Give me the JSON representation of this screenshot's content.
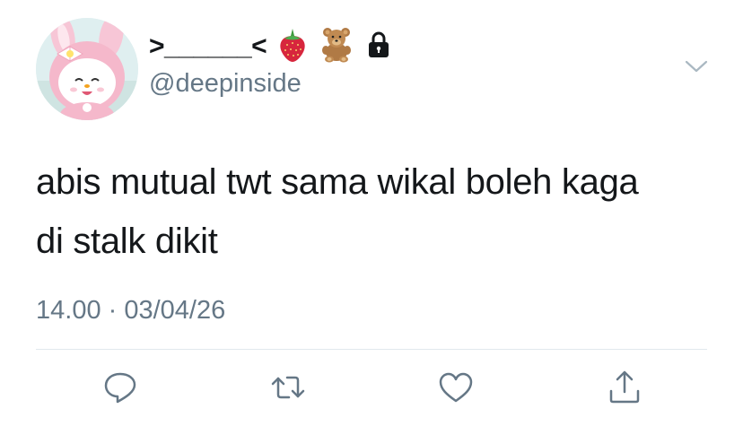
{
  "user": {
    "display_name": ">______<",
    "name_emojis": [
      "strawberry-icon",
      "teddy-bear-icon",
      "lock-icon"
    ],
    "handle": "@deepinside"
  },
  "tweet": {
    "text": "abis mutual twt sama wikal boleh kaga\ndi stalk dikit",
    "timestamp": "14.00 · 03/04/26"
  },
  "actions": [
    "reply-icon",
    "retweet-icon",
    "like-icon",
    "share-icon"
  ],
  "colors": {
    "text": "#14171a",
    "secondary": "#657786",
    "divider": "#e1e8ed",
    "icon": "#657786"
  }
}
